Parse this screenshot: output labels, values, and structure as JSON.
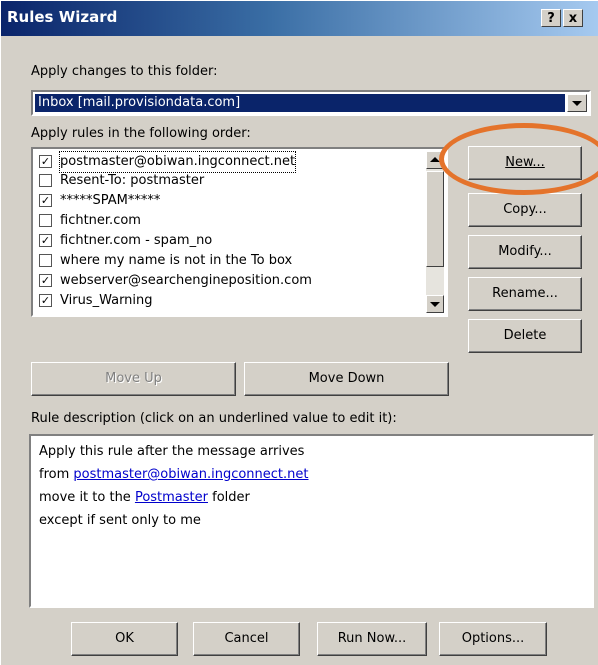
{
  "window": {
    "title": "Rules Wizard",
    "help_label": "?",
    "close_label": "x"
  },
  "folder": {
    "label": "Apply changes to this folder:",
    "value": "Inbox [mail.provisiondata.com]"
  },
  "rules_section": {
    "label": "Apply rules in the following order:"
  },
  "rules": [
    {
      "label": "postmaster@obiwan.ingconnect.net",
      "checked": true,
      "check_mark": "✓"
    },
    {
      "label": "Resent-To: postmaster",
      "checked": false,
      "check_mark": ""
    },
    {
      "label": "*****SPAM*****",
      "checked": true,
      "check_mark": "✓"
    },
    {
      "label": "fichtner.com",
      "checked": false,
      "check_mark": ""
    },
    {
      "label": "fichtner.com - spam_no",
      "checked": true,
      "check_mark": "✓"
    },
    {
      "label": "where my name is not in the To box",
      "checked": false,
      "check_mark": ""
    },
    {
      "label": "webserver@searchengineposition.com",
      "checked": true,
      "check_mark": "✓"
    },
    {
      "label": "Virus_Warning",
      "checked": true,
      "check_mark": "✓"
    }
  ],
  "side_buttons": {
    "new": "New...",
    "copy": "Copy...",
    "modify": "Modify...",
    "rename": "Rename...",
    "delete": "Delete"
  },
  "move_buttons": {
    "up": "Move Up",
    "down": "Move Down"
  },
  "description": {
    "label": "Rule description (click on an underlined value to edit it):",
    "line1": "Apply this rule after the message arrives",
    "line2_prefix": "from ",
    "line2_link": "postmaster@obiwan.ingconnect.net",
    "line3_prefix": "move it to the ",
    "line3_link": "Postmaster",
    "line3_suffix": " folder",
    "line4": "except if sent only to me"
  },
  "footer_buttons": {
    "ok": "OK",
    "cancel": "Cancel",
    "run_now": "Run Now...",
    "options": "Options..."
  },
  "colors": {
    "title_start": "#0a246a",
    "title_end": "#a6caf0",
    "highlight": "#0a246a",
    "annotation": "#e4732b",
    "link": "#0000cc"
  }
}
